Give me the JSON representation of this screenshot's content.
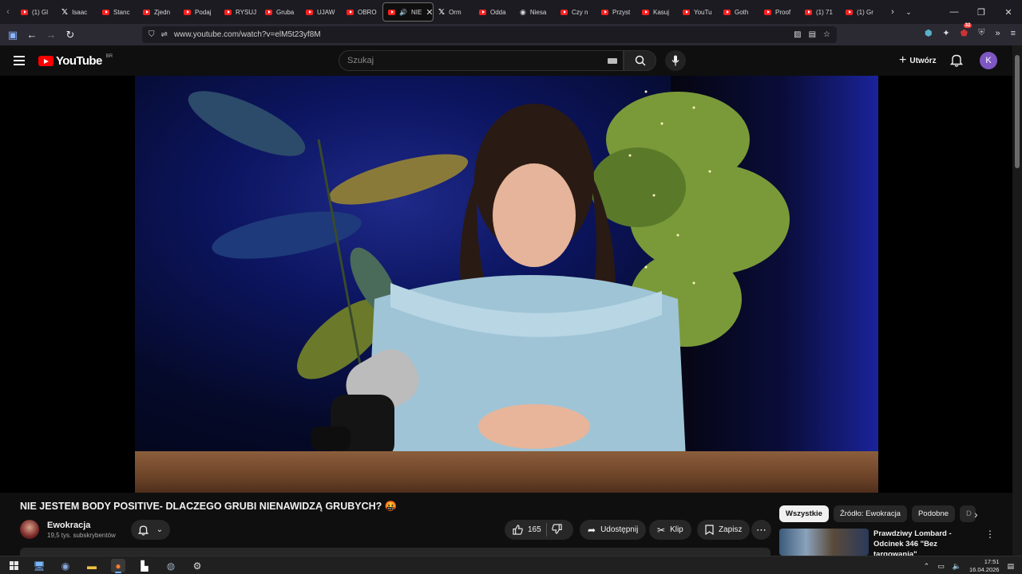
{
  "browser": {
    "tabs": [
      {
        "label": "(1) Gl",
        "icon": "youtube"
      },
      {
        "label": "Isaac",
        "icon": "x"
      },
      {
        "label": "Stanc",
        "icon": "youtube"
      },
      {
        "label": "Zjedn",
        "icon": "youtube"
      },
      {
        "label": "Podaj",
        "icon": "youtube"
      },
      {
        "label": "RYSUJ",
        "icon": "youtube"
      },
      {
        "label": "Gruba",
        "icon": "youtube"
      },
      {
        "label": "UJAW",
        "icon": "youtube"
      },
      {
        "label": "OBRO",
        "icon": "youtube"
      },
      {
        "label": "NIE",
        "icon": "youtube",
        "active": true
      },
      {
        "label": "Orm",
        "icon": "x"
      },
      {
        "label": "Odda",
        "icon": "youtube"
      },
      {
        "label": "Niesa",
        "icon": "circle"
      },
      {
        "label": "Czy n",
        "icon": "youtube"
      },
      {
        "label": "Przyst",
        "icon": "youtube"
      },
      {
        "label": "Kasuj",
        "icon": "youtube"
      },
      {
        "label": "YouTu",
        "icon": "youtube"
      },
      {
        "label": "Goth",
        "icon": "youtube"
      },
      {
        "label": "Proof",
        "icon": "youtube"
      },
      {
        "label": "(1) 71",
        "icon": "youtube"
      },
      {
        "label": "(1) Gr",
        "icon": "youtube"
      }
    ],
    "url": "www.youtube.com/watch?v=elM5t23yf8M",
    "extension_badge": "32"
  },
  "youtube": {
    "logo_text": "YouTube",
    "logo_region": "BR",
    "search_placeholder": "Szukaj",
    "create_label": "Utwórz",
    "avatar_letter": "K"
  },
  "video": {
    "title": "NIE JESTEM BODY POSITIVE- DLACZEGO GRUBI NIENAWIDZĄ GRUBYCH? 🤬",
    "channel": "Ewokracja",
    "subscribers": "19,5 tys. subskrybentów",
    "likes": "165",
    "share_label": "Udostępnij",
    "clip_label": "Klip",
    "save_label": "Zapisz"
  },
  "sidebar": {
    "chips": [
      "Wszystkie",
      "Źródło: Ewokracja",
      "Podobne",
      "D"
    ],
    "recommended": [
      {
        "title": "Prawdziwy Lombard - Odcinek 346 \"Bez targowania\""
      }
    ]
  },
  "taskbar": {
    "time": "17:51",
    "date": "16.04.2026"
  },
  "colors": {
    "background": "#0f0f0f",
    "brand_red": "#ff0000",
    "chip_bg": "#272727",
    "avatar": "#7e57c2"
  }
}
